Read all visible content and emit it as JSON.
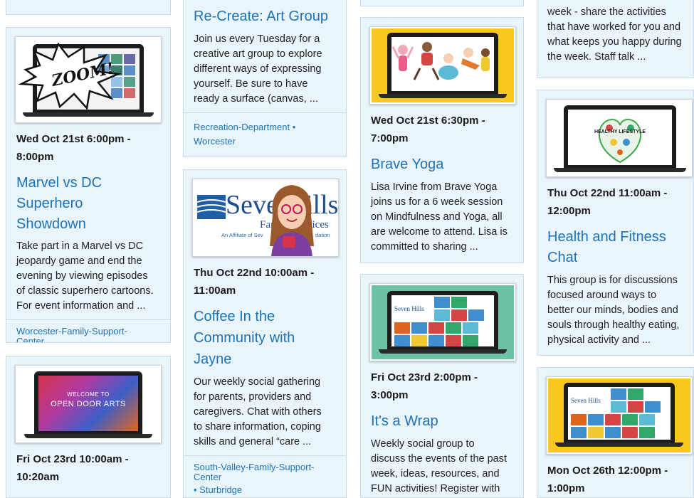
{
  "columns": {
    "col1": {
      "card1": {
        "date_line1": "Wed Oct 21st 6:00pm -",
        "date_line2": "8:00pm",
        "title_lines": [
          "Marvel vs DC",
          "Superhero",
          "Showdown"
        ],
        "desc_lines": [
          "Take part in a Marvel vs DC",
          "jeopardy game and end the",
          "evening by viewing episodes",
          "of classic superhero cartoons.",
          "For event information and ..."
        ],
        "meta_lines": [
          "Worcester-Family-Support-",
          "Center"
        ],
        "image_text": "ZOOM!"
      },
      "card2": {
        "image_text_1": "WELCOME TO",
        "image_text_2": "OPEN DOOR ARTS",
        "date_line1": "Fri Oct 23rd 10:00am -",
        "date_line2": "10:20am"
      }
    },
    "col2": {
      "card1": {
        "title": "Re-Create: Art Group",
        "desc_lines": [
          "Join us every Tuesday for a",
          "creative art group to explore",
          "different ways of expressing",
          "yourself. Be sure to have",
          "ready a surface (canvas, ..."
        ],
        "meta_lines": [
          "Recreation-Department •",
          "Worcester"
        ]
      },
      "card2": {
        "logo_word": "Seven",
        "logo_word_end": "ills",
        "logo_sub": "Fam",
        "logo_sub_end": "vices",
        "logo_affiliate": "An Affiliate of Sev",
        "logo_affiliate_end": "dation",
        "date_line1": "Thu Oct 22nd 10:00am -",
        "date_line2": "11:00am",
        "title_lines": [
          "Coffee In the",
          "Community with",
          "Jayne"
        ],
        "desc_lines": [
          "Our weekly social gathering",
          "for parents, providers and",
          "caregivers. Chat with others",
          "to share information, coping",
          "skills and general “care ..."
        ],
        "meta_lines": [
          "South-Valley-Family-Support-",
          "Center",
          "• Sturbridge"
        ]
      }
    },
    "col3": {
      "card1": {
        "date_line1": "Wed Oct 21st 6:30pm -",
        "date_line2": "7:00pm",
        "title": "Brave Yoga",
        "desc_lines": [
          "Lisa Irvine from Brave Yoga",
          "joins us for a 6 week session",
          "on Mindfulness and Yoga, all",
          "are welcome to attend. Lisa is",
          "committed to sharing ..."
        ]
      },
      "card2": {
        "logo_text": "Seven Hills",
        "date_line1": "Fri Oct 23rd 2:00pm -",
        "date_line2": "3:00pm",
        "title": "It's a Wrap",
        "desc_lines": [
          "Weekly social group to",
          "discuss the events of the past",
          "week, ideas, resources, and",
          "FUN activities! Register with"
        ]
      }
    },
    "col4": {
      "card1": {
        "desc_lines": [
          "week - share the activities",
          "that have worked for you and",
          "what keeps you happy during",
          "the week. Staff talk ..."
        ]
      },
      "card2": {
        "image_text": "HEALTHY LIFESTYLE",
        "date_line1": "Thu Oct 22nd 11:00am -",
        "date_line2": "12:00pm",
        "title_lines": [
          "Health and Fitness",
          "Chat"
        ],
        "desc_lines": [
          "This group is for discussions",
          "focused around ways to",
          "better our minds, bodies and",
          "souls through healthy eating,",
          "physical activity and ..."
        ]
      },
      "card3": {
        "logo_text": "Seven Hills",
        "date_line1": "Mon Oct 26th 12:00pm -",
        "date_line2": "1:00pm"
      }
    }
  },
  "colors": {
    "card_bg": "#eaf4fb",
    "card_border": "#c9dbe6",
    "link_blue": "#1c73b8",
    "yellow": "#f8c81c",
    "teal": "#6cc3a3",
    "seven_hills_blue": "#1f5fa8"
  }
}
